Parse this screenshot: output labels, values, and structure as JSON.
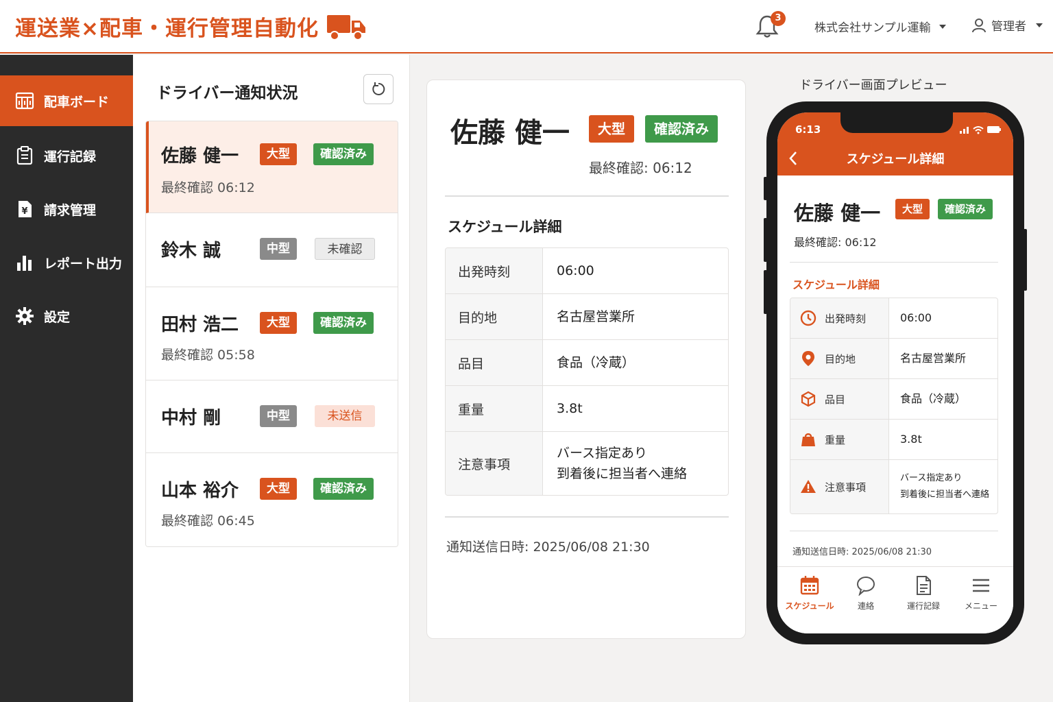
{
  "header": {
    "brand": "運送業×配車・運行管理自動化",
    "notification_count": "3",
    "company": "株式会社サンプル運輸",
    "user": "管理者"
  },
  "colors": {
    "accent": "#d9531e",
    "confirmed": "#3f9a4a",
    "medium": "#8a8a8a",
    "sidebar": "#2b2b2b"
  },
  "sidebar": {
    "items": [
      {
        "label": "配車ボード",
        "icon": "dispatch-board-icon",
        "active": true
      },
      {
        "label": "運行記録",
        "icon": "clipboard-icon",
        "active": false
      },
      {
        "label": "請求管理",
        "icon": "invoice-icon",
        "active": false
      },
      {
        "label": "レポート出力",
        "icon": "bar-chart-icon",
        "active": false
      },
      {
        "label": "設定",
        "icon": "gear-icon",
        "active": false
      }
    ]
  },
  "driver_list": {
    "title": "ドライバー通知状況",
    "drivers": [
      {
        "name": "佐藤 健一",
        "size": "大型",
        "status": "確認済み",
        "last_confirm": "最終確認 06:12"
      },
      {
        "name": "鈴木 誠",
        "size": "中型",
        "status": "未確認",
        "last_confirm": ""
      },
      {
        "name": "田村 浩二",
        "size": "大型",
        "status": "確認済み",
        "last_confirm": "最終確認 05:58"
      },
      {
        "name": "中村 剛",
        "size": "中型",
        "status": "未送信",
        "last_confirm": ""
      },
      {
        "name": "山本 裕介",
        "size": "大型",
        "status": "確認済み",
        "last_confirm": "最終確認 06:45"
      }
    ]
  },
  "detail": {
    "name": "佐藤 健一",
    "size": "大型",
    "status": "確認済み",
    "last_confirm": "最終確認: 06:12",
    "schedule_title": "スケジュール詳細",
    "rows": [
      {
        "key": "出発時刻",
        "value": "06:00",
        "value2": ""
      },
      {
        "key": "目的地",
        "value": "名古屋営業所",
        "value2": ""
      },
      {
        "key": "品目",
        "value": "食品（冷蔵）",
        "value2": ""
      },
      {
        "key": "重量",
        "value": "3.8t",
        "value2": ""
      },
      {
        "key": "注意事項",
        "value": "バース指定あり",
        "value2": "到着後に担当者へ連絡"
      }
    ],
    "sent_at": "通知送信日時: 2025/06/08 21:30"
  },
  "preview": {
    "label": "ドライバー画面プレビュー",
    "time": "6:13",
    "title": "スケジュール詳細",
    "name": "佐藤 健一",
    "size": "大型",
    "status": "確認済み",
    "last_confirm": "最終確認: 06:12",
    "schedule_title": "スケジュール詳細",
    "rows": [
      {
        "key": "出発時刻",
        "icon": "clock-icon",
        "value": "06:00",
        "value2": ""
      },
      {
        "key": "目的地",
        "icon": "location-pin-icon",
        "value": "名古屋営業所",
        "value2": ""
      },
      {
        "key": "品目",
        "icon": "package-icon",
        "value": "食品（冷蔵）",
        "value2": ""
      },
      {
        "key": "重量",
        "icon": "weight-icon",
        "value": "3.8t",
        "value2": ""
      },
      {
        "key": "注意事項",
        "icon": "warning-icon",
        "value": "バース指定あり",
        "value2": "到着後に担当者へ連絡"
      }
    ],
    "sent_at": "通知送信日時: 2025/06/08 21:30",
    "tabs": [
      {
        "label": "スケジュール",
        "icon": "calendar-icon",
        "active": true
      },
      {
        "label": "連絡",
        "icon": "chat-bubble-icon",
        "active": false
      },
      {
        "label": "運行記録",
        "icon": "document-icon",
        "active": false
      },
      {
        "label": "メニュー",
        "icon": "menu-icon",
        "active": false
      }
    ]
  }
}
